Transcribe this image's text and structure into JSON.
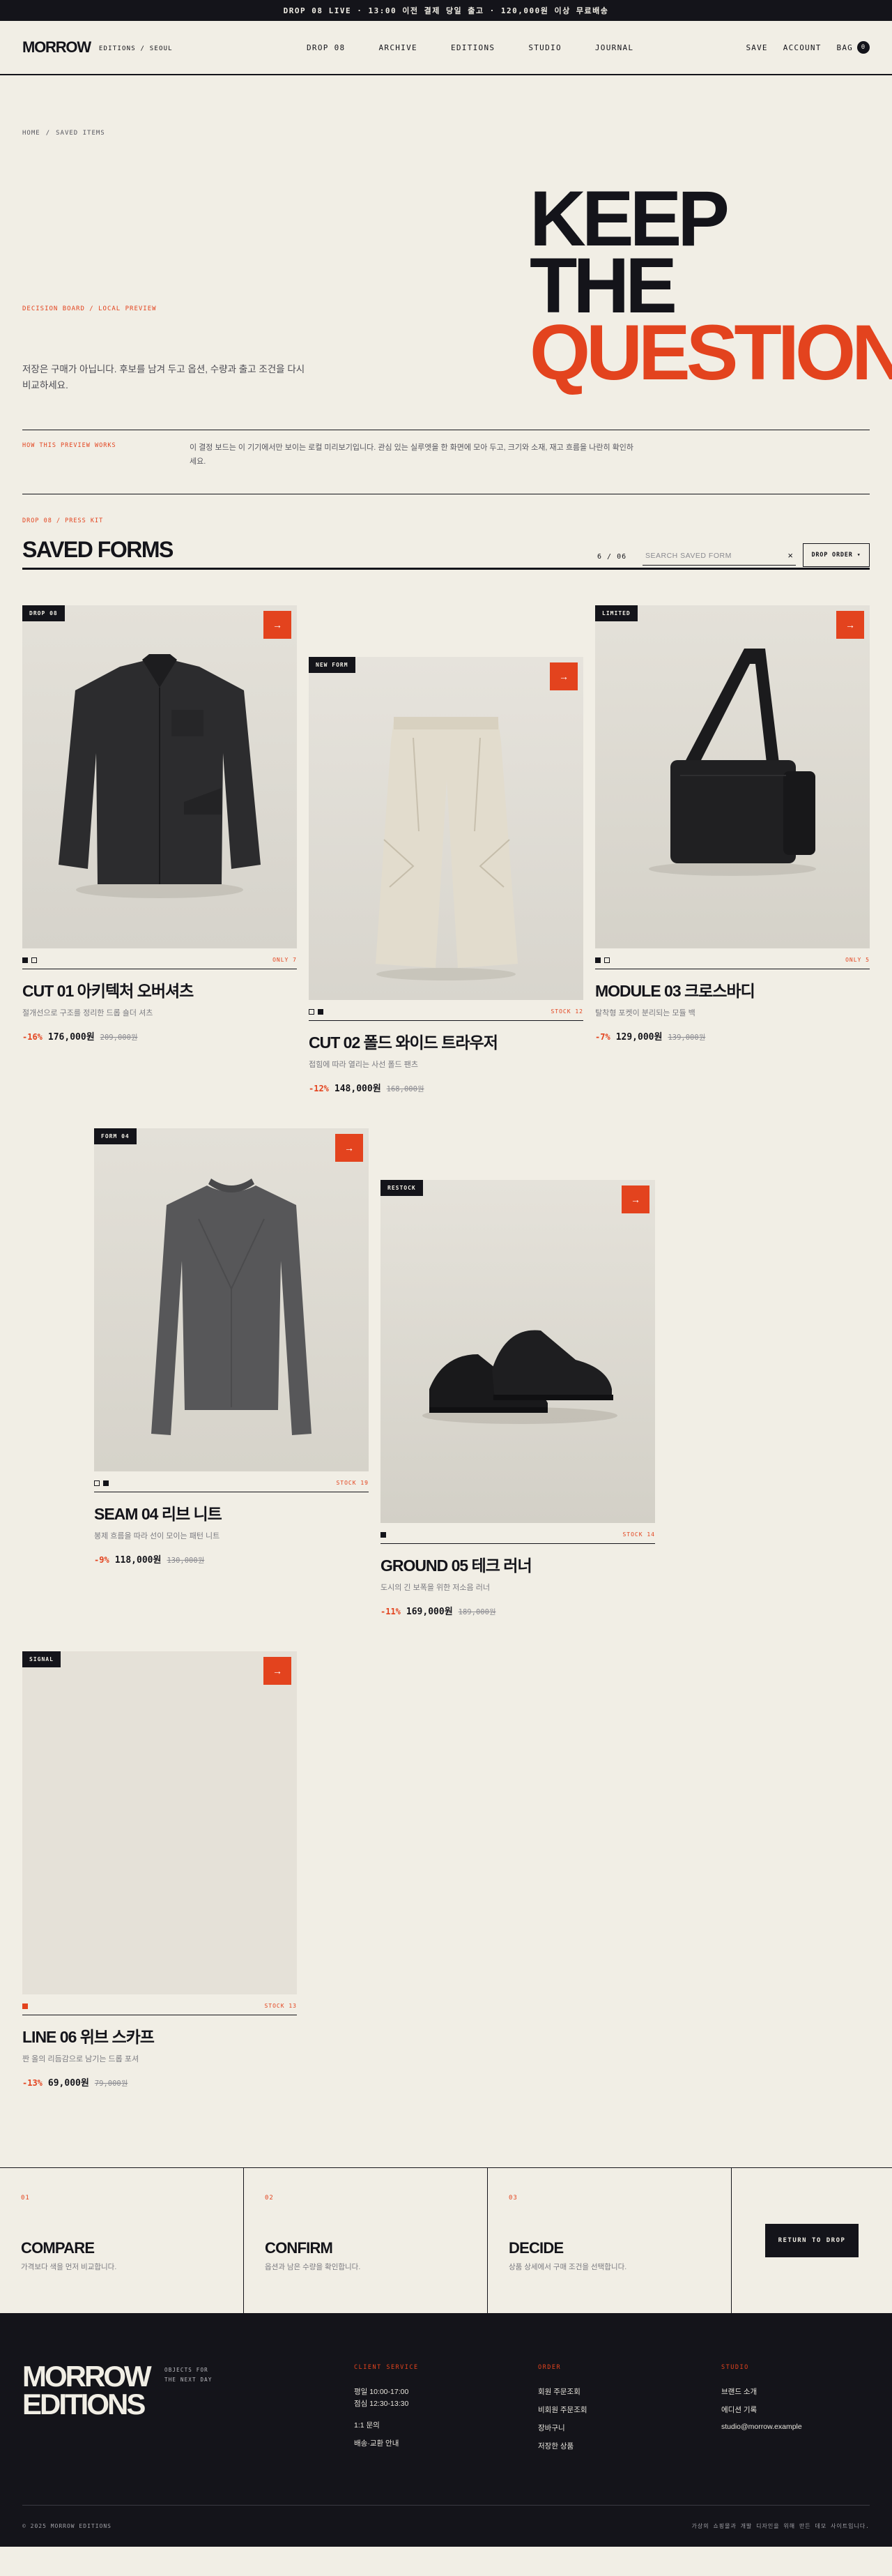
{
  "announcement": "DROP 08 LIVE  ·  13:00 이전 결제 당일 출고  ·  120,000원 이상 무료배송",
  "header": {
    "logo": "MORROW",
    "logo_sub": "EDITIONS / SEOUL",
    "nav": [
      "DROP 08",
      "ARCHIVE",
      "EDITIONS",
      "STUDIO",
      "JOURNAL"
    ],
    "save": "SAVE",
    "account": "ACCOUNT",
    "bag": "BAG",
    "bag_count": "0"
  },
  "hero": {
    "breadcrumb": [
      "HOME",
      "/",
      "SAVED ITEMS"
    ],
    "title_line1": "KEEP THE",
    "title_line2": "QUESTION.",
    "kicker": "DECISION BOARD / LOCAL PREVIEW",
    "lead": "저장은 구매가 아닙니다. 후보를 남겨 두고 옵션, 수량과 출고 조건을 다시 비교하세요.",
    "how_label": "HOW THIS PREVIEW WORKS",
    "how_text": "이 결정 보드는 이 기기에서만 보이는 로컬 미리보기입니다. 관심 있는 실루엣을 한 화면에 모아 두고, 크기와 소재, 재고 흐름을 나란히 확인하세요."
  },
  "list": {
    "kicker": "DROP 08 / PRESS KIT",
    "title": "SAVED FORMS",
    "count": "6 / 06",
    "search_placeholder": "SEARCH SAVED FORM",
    "clear": "×",
    "sort": "DROP ORDER",
    "sort_icon": "▾"
  },
  "products": [
    {
      "badge": "DROP 08",
      "stock": "ONLY 7",
      "name": "CUT 01 아키텍처 오버셔츠",
      "desc": "절개선으로 구조를 정리한 드롭 숄더 셔츠",
      "discount": "-16%",
      "price": "176,000원",
      "was": "209,000원"
    },
    {
      "badge": "NEW FORM",
      "stock": "STOCK 12",
      "name": "CUT 02 폴드 와이드 트라우저",
      "desc": "접힘에 따라 열리는 사선 폴드 팬츠",
      "discount": "-12%",
      "price": "148,000원",
      "was": "168,000원"
    },
    {
      "badge": "LIMITED",
      "stock": "ONLY 5",
      "name": "MODULE 03 크로스바디",
      "desc": "탈착형 포켓이 분리되는 모듈 백",
      "discount": "-7%",
      "price": "129,000원",
      "was": "139,000원"
    },
    {
      "badge": "FORM 04",
      "stock": "STOCK 19",
      "name": "SEAM 04 리브 니트",
      "desc": "봉제 흐름을 따라 선이 모이는 패턴 니트",
      "discount": "-9%",
      "price": "118,000원",
      "was": "130,000원"
    },
    {
      "badge": "RESTOCK",
      "stock": "STOCK 14",
      "name": "GROUND 05 테크 러너",
      "desc": "도시의 긴 보폭을 위한 저소음 러너",
      "discount": "-11%",
      "price": "169,000원",
      "was": "189,000원"
    },
    {
      "badge": "SIGNAL",
      "stock": "STOCK 13",
      "name": "LINE 06 위브 스카프",
      "desc": "짠 올의 리듬감으로 남기는 드롭 포셔",
      "discount": "-13%",
      "price": "69,000원",
      "was": "79,000원"
    }
  ],
  "steps": [
    {
      "num": "01",
      "title": "COMPARE",
      "desc": "가격보다 색을 먼저 비교합니다."
    },
    {
      "num": "02",
      "title": "CONFIRM",
      "desc": "옵션과 남은 수량을 확인합니다."
    },
    {
      "num": "03",
      "title": "DECIDE",
      "desc": "상품 상세에서 구매 조건을 선택합니다."
    }
  ],
  "cta": "RETURN TO DROP",
  "footer": {
    "logo_line1": "MORROW",
    "logo_line2": "EDITIONS",
    "tagline_1": "OBJECTS FOR",
    "tagline_2": "THE NEXT DAY",
    "col1": {
      "title": "CLIENT SERVICE",
      "lines": [
        "평일 10:00-17:00",
        "점심 12:30-13:30"
      ],
      "links": [
        "1:1 문의",
        "배송·교환 안내"
      ]
    },
    "col2": {
      "title": "ORDER",
      "links": [
        "회원 주문조회",
        "비회원 주문조회",
        "장바구니",
        "저장한 상품"
      ]
    },
    "col3": {
      "title": "STUDIO",
      "links": [
        "브랜드 소개",
        "에디션 기록",
        "studio@morrow.example"
      ]
    },
    "copyright": "© 2025 MORROW EDITIONS",
    "note": "가상의 쇼핑몰과 개발 디자인을 위해 만든 데모 사이트입니다."
  },
  "colors": {
    "accent": "#e3431e",
    "ink": "#14141a",
    "paper": "#f1eee5"
  }
}
